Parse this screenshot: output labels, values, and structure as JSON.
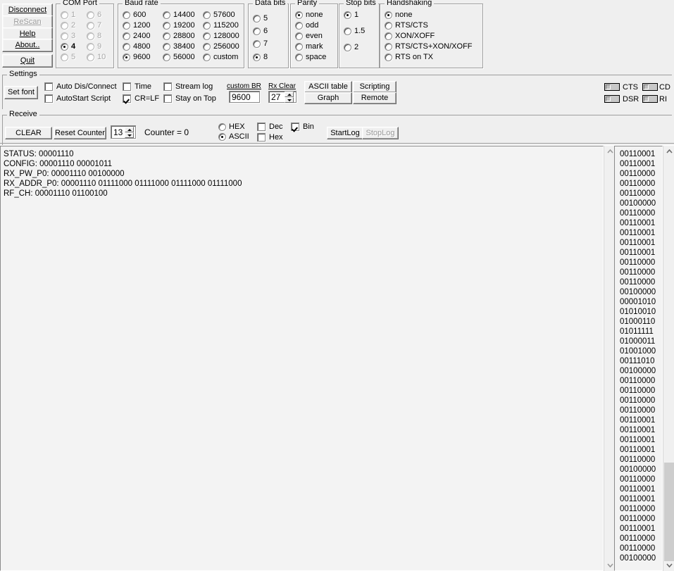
{
  "app": {
    "name": "Serial Port Terminal"
  },
  "left_buttons": [
    {
      "label": "Disconnect",
      "name": "disconnect-button",
      "enabled": true,
      "accel": "D"
    },
    {
      "label": "ReScan",
      "name": "rescan-button",
      "enabled": false,
      "accel": "R"
    },
    {
      "label": "Help",
      "name": "help-button",
      "enabled": true,
      "accel": "H"
    },
    {
      "label": "About..",
      "name": "about-button",
      "enabled": true,
      "accel": "A"
    },
    {
      "label": "Quit",
      "name": "quit-button",
      "enabled": true,
      "accel": "Q"
    }
  ],
  "com_port": {
    "title": "COM Port",
    "selected": "4",
    "col1": [
      {
        "label": "1",
        "enabled": false
      },
      {
        "label": "2",
        "enabled": false
      },
      {
        "label": "3",
        "enabled": false
      },
      {
        "label": "4",
        "enabled": true
      },
      {
        "label": "5",
        "enabled": false
      }
    ],
    "col2": [
      {
        "label": "6",
        "enabled": false
      },
      {
        "label": "7",
        "enabled": false
      },
      {
        "label": "8",
        "enabled": false
      },
      {
        "label": "9",
        "enabled": false
      },
      {
        "label": "10",
        "enabled": false
      }
    ]
  },
  "baud_rate": {
    "title": "Baud rate",
    "selected": "9600",
    "col1": [
      "600",
      "1200",
      "2400",
      "4800",
      "9600"
    ],
    "col2": [
      "14400",
      "19200",
      "28800",
      "38400",
      "56000"
    ],
    "col3": [
      "57600",
      "115200",
      "128000",
      "256000",
      "custom"
    ]
  },
  "data_bits": {
    "title": "Data bits",
    "selected": "8",
    "options": [
      "5",
      "6",
      "7",
      "8"
    ]
  },
  "parity": {
    "title": "Parity",
    "selected": "none",
    "options": [
      "none",
      "odd",
      "even",
      "mark",
      "space"
    ]
  },
  "stop_bits": {
    "title": "Stop bits",
    "selected": "1",
    "options": [
      "1",
      "1.5",
      "2"
    ]
  },
  "handshaking": {
    "title": "Handshaking",
    "selected": "none",
    "options": [
      "none",
      "RTS/CTS",
      "XON/XOFF",
      "RTS/CTS+XON/XOFF",
      "RTS on TX"
    ]
  },
  "settings": {
    "title": "Settings",
    "set_font_label": "Set font",
    "checks": [
      {
        "label": "Auto Dis/Connect",
        "checked": false
      },
      {
        "label": "AutoStart Script",
        "checked": false
      },
      {
        "label": "Time",
        "checked": false
      },
      {
        "label": "CR=LF",
        "checked": true
      },
      {
        "label": "Stream log",
        "checked": false
      },
      {
        "label": "Stay on Top",
        "checked": false
      }
    ],
    "custom_br_label": "custom BR",
    "custom_br_value": "9600",
    "rx_clear_label": "Rx Clear",
    "rx_clear_value": "27",
    "buttons": [
      {
        "label": "ASCII table",
        "name": "ascii-table-button"
      },
      {
        "label": "Scripting",
        "name": "scripting-button"
      },
      {
        "label": "Graph",
        "name": "graph-button"
      },
      {
        "label": "Remote",
        "name": "remote-button"
      }
    ],
    "leds": [
      {
        "label": "CTS"
      },
      {
        "label": "CD"
      },
      {
        "label": "DSR"
      },
      {
        "label": "RI"
      }
    ]
  },
  "receive": {
    "title": "Receive",
    "clear_label": "CLEAR",
    "reset_counter_label": "Reset Counter",
    "counter_field_value": "13",
    "counter_text": "Counter =  0",
    "format_radios": [
      {
        "label": "HEX",
        "selected": false
      },
      {
        "label": "ASCII",
        "selected": true
      }
    ],
    "format_checks": [
      {
        "label": "Dec",
        "checked": false
      },
      {
        "label": "Hex",
        "checked": false
      },
      {
        "label": "Bin",
        "checked": true
      }
    ],
    "start_log_label": "StartLog",
    "stop_log_label": "StopLog",
    "stop_log_enabled": false
  },
  "terminal": {
    "main_lines": [
      "STATUS: 00001110",
      "CONFIG: 00001110 00001011",
      "RX_PW_P0: 00001110 00100000",
      "RX_ADDR_P0: 00001110 01111000 01111000 01111000 01111000",
      "RF_CH: 00001110 01100100"
    ],
    "side_lines": [
      "00110001",
      "00110001",
      "00110000",
      "00110000",
      "00110000",
      "00100000",
      "00110000",
      "00110001",
      "00110001",
      "00110001",
      "00110001",
      "00110000",
      "00110000",
      "00110000",
      "00100000",
      "00001010",
      "01010010",
      "01000110",
      "01011111",
      "01000011",
      "01001000",
      "00111010",
      "00100000",
      "00110000",
      "00110000",
      "00110000",
      "00110000",
      "00110001",
      "00110001",
      "00110001",
      "00110001",
      "00110000",
      "00100000",
      "00110000",
      "00110001",
      "00110001",
      "00110000",
      "00110000",
      "00110001",
      "00110000",
      "00110000",
      "00100000"
    ]
  }
}
